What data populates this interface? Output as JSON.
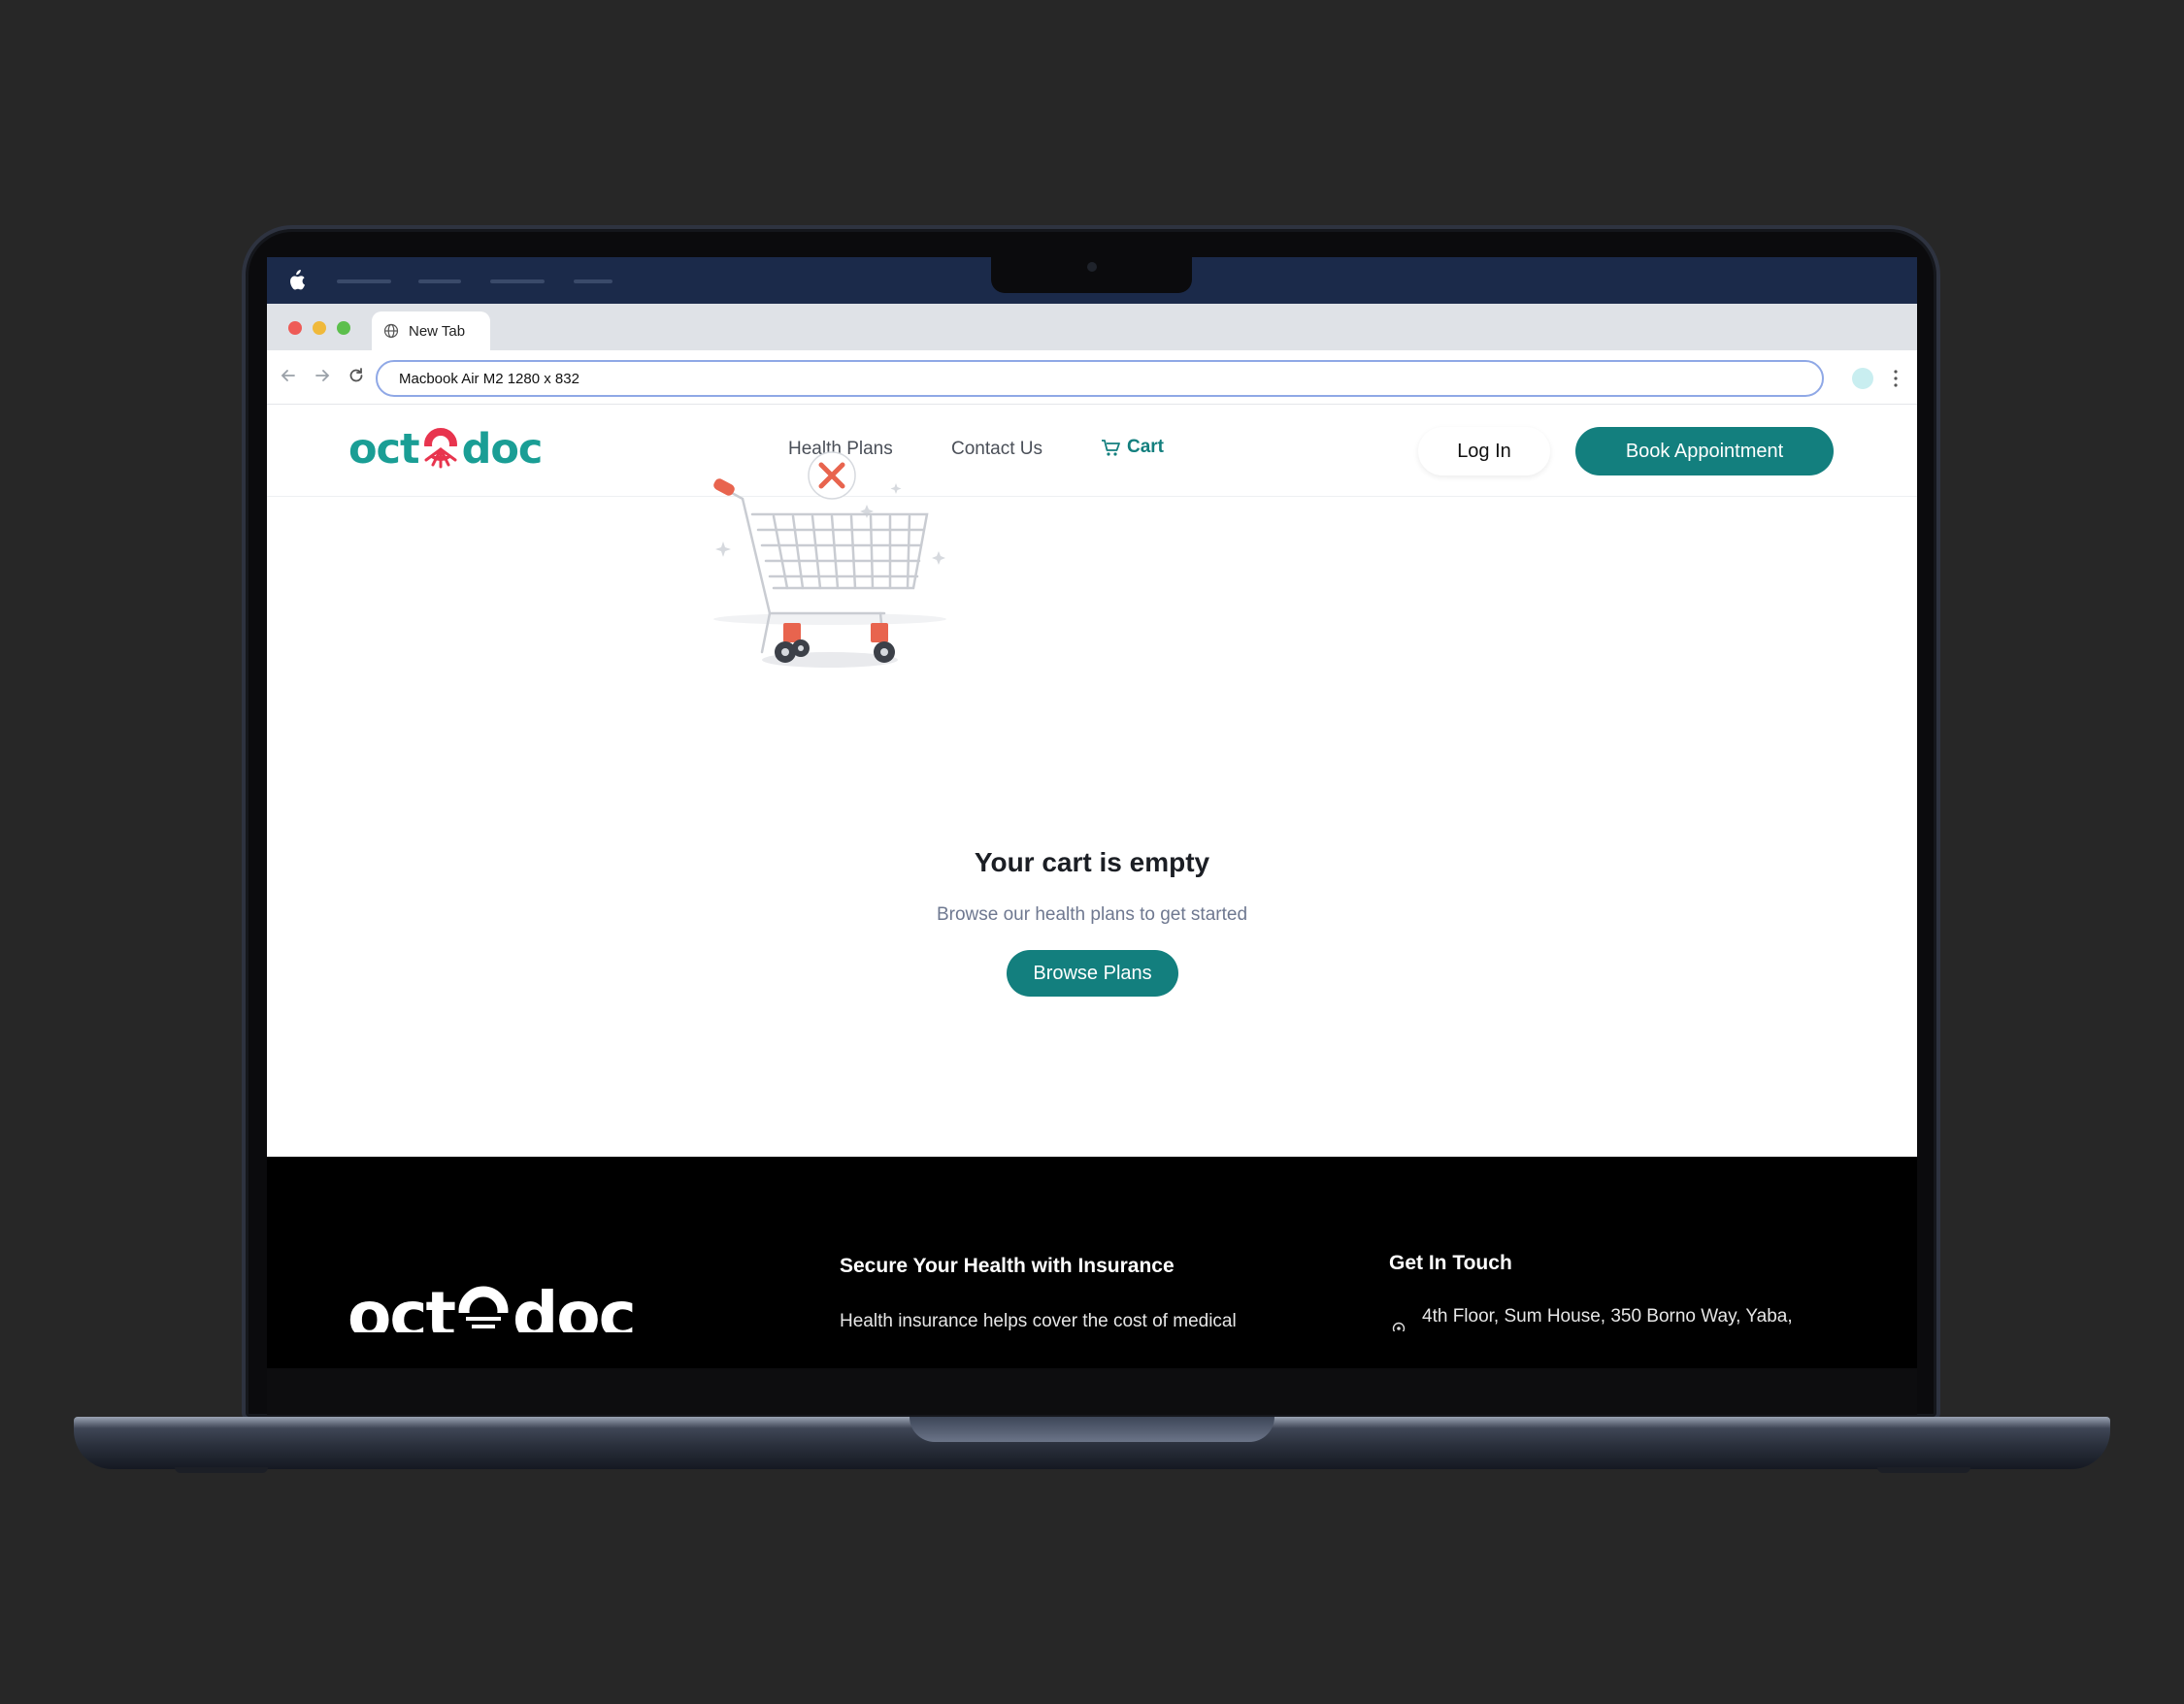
{
  "browser": {
    "tab_title": "New Tab",
    "url": "Macbook Air M2  1280 x 832"
  },
  "site": {
    "logo_left": "oct",
    "logo_right": "doc",
    "nav": {
      "health_plans": "Health Plans",
      "contact_us": "Contact Us",
      "cart": "Cart"
    },
    "login_label": "Log In",
    "book_label": "Book Appointment",
    "empty_cart": {
      "title": "Your cart is empty",
      "subtitle": "Browse our health plans to get started",
      "button": "Browse Plans"
    },
    "footer": {
      "tagline_heading": "Secure Your Health with Insurance",
      "tagline_text": "Health insurance helps cover the cost of medical",
      "contact_heading": "Get In Touch",
      "address": "4th Floor, Sum House, 350 Borno Way, Yaba,"
    }
  },
  "colors": {
    "brand_teal": "#137f7e",
    "logo_teal": "#1a9e95",
    "accent_red": "#e8344e",
    "menubar": "#1b2a4a",
    "backdrop": "#272727"
  },
  "icons": [
    "apple-icon",
    "globe-icon",
    "back-arrow-icon",
    "forward-arrow-icon",
    "reload-icon",
    "profile-icon",
    "more-icon",
    "cart-icon",
    "location-icon",
    "shopping-cart-illustration",
    "close-badge-icon"
  ]
}
